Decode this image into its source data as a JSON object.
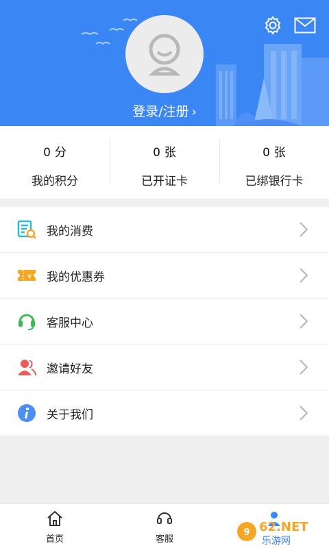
{
  "header": {
    "login_text": "登录/注册",
    "login_chevron": "›",
    "settings_icon": "gear-icon",
    "mail_icon": "mail-icon",
    "avatar_icon": "default-avatar-icon",
    "background_color": "#3b86f5"
  },
  "stats": [
    {
      "value": "0",
      "unit": "分",
      "label": "我的积分"
    },
    {
      "value": "0",
      "unit": "张",
      "label": "已开证卡"
    },
    {
      "value": "0",
      "unit": "张",
      "label": "已绑银行卡"
    }
  ],
  "menu": [
    {
      "label": "我的消费",
      "icon": "receipt-search-icon",
      "color": "#2bb5d6"
    },
    {
      "label": "我的优惠券",
      "icon": "coupon-icon",
      "color": "#f5a623"
    },
    {
      "label": "客服中心",
      "icon": "headset-icon",
      "color": "#3cba54"
    },
    {
      "label": "邀请好友",
      "icon": "invite-friend-icon",
      "color": "#ec5a5a"
    },
    {
      "label": "关于我们",
      "icon": "info-icon",
      "color": "#3b86f5"
    }
  ],
  "tabbar": [
    {
      "label": "首页",
      "icon": "home-icon"
    },
    {
      "label": "客服",
      "icon": "headset-icon"
    },
    {
      "label": "",
      "icon": "profile-icon",
      "active": true
    }
  ],
  "watermark": {
    "text": "962.NET",
    "subtext": "乐游网"
  }
}
